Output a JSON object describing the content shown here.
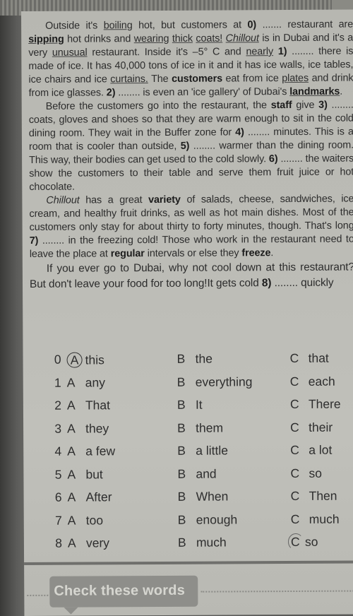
{
  "passage": {
    "p1": {
      "s1": "Outside it's ",
      "w_boiling": "boiling",
      "s2": " hot, but customers at ",
      "g0": "0)",
      "s3": " ....... restaurant are ",
      "w_sipping": "sipping",
      "s4": " hot drinks and ",
      "w_wearing": "wearing",
      "s5": " ",
      "w_thick": "thick",
      "s6": " ",
      "w_coats": "coats!",
      "s7": " ",
      "w_chillout": "Chillout",
      "s8": " is in Dubai and it's a very ",
      "w_unusual": "unusual",
      "s9": " restaurant. Inside it's –5° C and ",
      "w_nearly": "nearly",
      "s10": " ",
      "g1": "1)",
      "s11": " ........ there is made of ice. It has 40,000 tons of ice in it and it has ice walls, ice tables, ice chairs and ice ",
      "w_curtains": "curtains.",
      "s12": " The ",
      "w_customers": "customers",
      "s13": " eat from ice ",
      "w_plates": "plates",
      "s14": " and drink from ice glasses. ",
      "g2": "2)",
      "s15": " ........ is even an 'ice gallery' of Dubai's ",
      "w_landmarks": "landmarks",
      "s16": "."
    },
    "p2": {
      "s1": "Before the customers go into the restaurant, the ",
      "w_staff": "staff",
      "s2": " give ",
      "g3": "3)",
      "s3": " ........ coats, gloves and shoes so that they are warm enough to sit in the cold dining room. They wait in the Buffer zone for ",
      "g4": "4)",
      "s4": " ........ minutes. This is a room that is cooler than outside, ",
      "g5": "5)",
      "s5": " ........ warmer than the dining room. This way, their bodies can get used to the cold slowly. ",
      "g6": "6)",
      "s6": " ........ the waiters show the customers to their table and serve them fruit juice or hot chocolate."
    },
    "p3": {
      "w_chillout": "Chillout",
      "s1": " has a great ",
      "w_variety": "variety",
      "s2": " of salads, cheese, sandwiches, ice cream, and healthy fruit drinks, as well as hot main dishes. Most of the customers only stay for about thirty to forty minutes, though. That's long ",
      "g7": "7)",
      "s3": " ........ in the freezing cold! Those who work in the restaurant need to leave the place at ",
      "w_regular": "regular",
      "s4": " intervals or else they ",
      "w_freeze": "freeze",
      "s5": "."
    },
    "p4": {
      "s1": "If you ever go to Dubai, why not cool down at this restaurant? But don't leave your food for too long!It gets cold ",
      "g8": "8)",
      "s2": " ........ quickly"
    }
  },
  "options": [
    {
      "num": "0",
      "a": "this",
      "b": "the",
      "c": "that",
      "marked": "A"
    },
    {
      "num": "1",
      "a": "any",
      "b": "everything",
      "c": "each"
    },
    {
      "num": "2",
      "a": "That",
      "b": "It",
      "c": "There"
    },
    {
      "num": "3",
      "a": "they",
      "b": "them",
      "c": "their"
    },
    {
      "num": "4",
      "a": "a few",
      "b": "a little",
      "c": "a lot"
    },
    {
      "num": "5",
      "a": "but",
      "b": "and",
      "c": "so"
    },
    {
      "num": "6",
      "a": "After",
      "b": "When",
      "c": "Then"
    },
    {
      "num": "7",
      "a": "too",
      "b": "enough",
      "c": "much"
    },
    {
      "num": "8",
      "a": "very",
      "b": "much",
      "c": "so",
      "marked": "C"
    }
  ],
  "letters": {
    "a": "A",
    "b": "B",
    "c": "C"
  },
  "section": {
    "title": "Check these words"
  }
}
